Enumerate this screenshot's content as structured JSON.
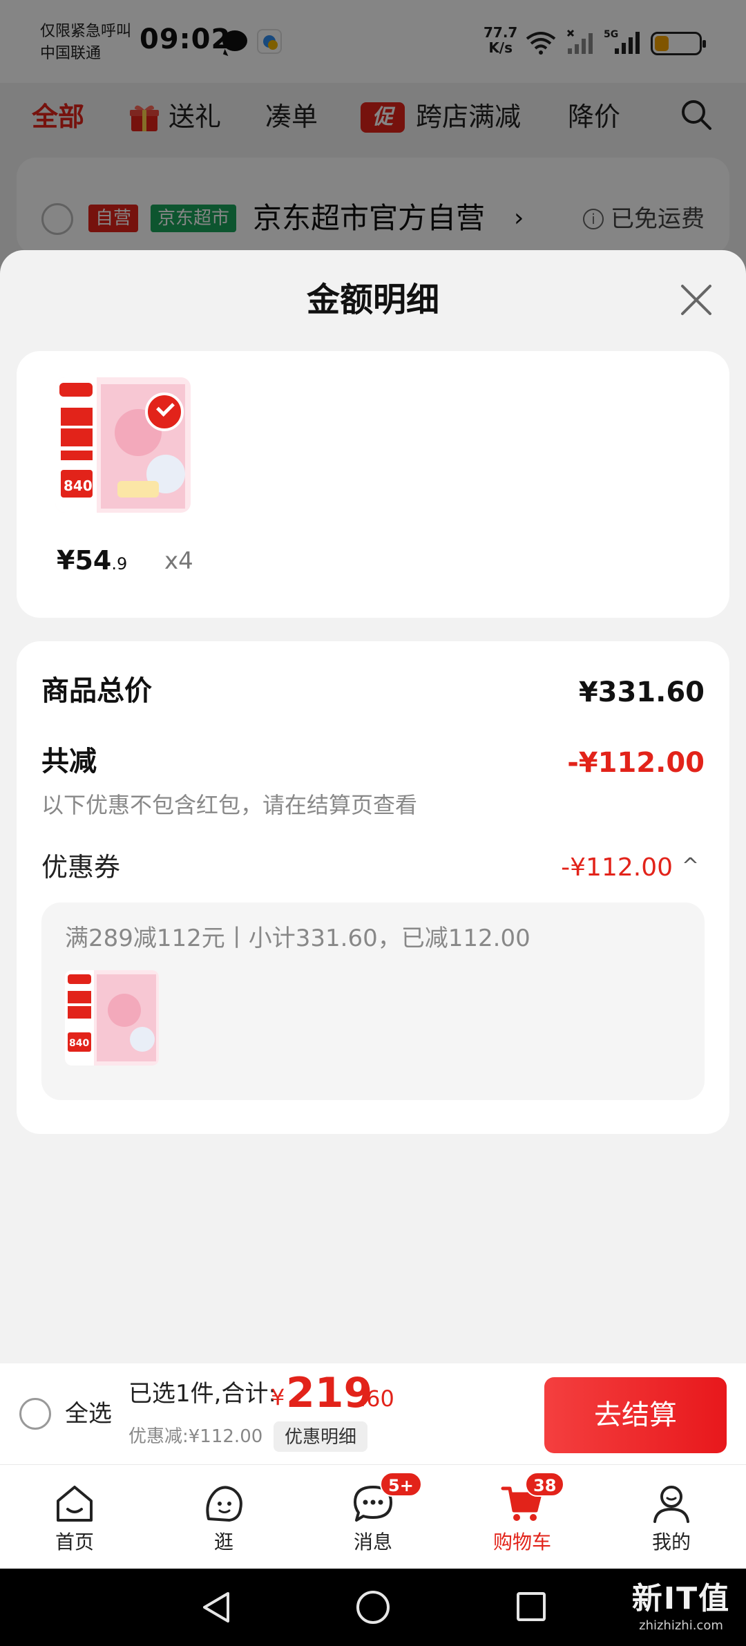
{
  "status_bar": {
    "carrier_line1": "仅限紧急呼叫",
    "carrier_line2": "中国联通",
    "time": "09:02",
    "speed_value": "77.7",
    "speed_unit": "K/s",
    "network": "5G"
  },
  "filter_tabs": {
    "all": "全部",
    "gift": "送礼",
    "bundle": "凑单",
    "promo_badge": "促",
    "cross_store": "跨店满减",
    "price_drop": "降价"
  },
  "shop": {
    "tag_self": "自营",
    "tag_market": "京东超市",
    "name": "京东超市官方自营",
    "chevron": "›",
    "shipping": "已免运费"
  },
  "sheet": {
    "title": "金额明细",
    "item": {
      "price_int": "¥54",
      "price_dec": ".9",
      "qty": "x4"
    },
    "summary": {
      "total_label": "商品总价",
      "total_value": "¥331.60",
      "reduce_label": "共减",
      "reduce_value": "-¥112.00",
      "hint": "以下优惠不包含红包，请在结算页查看",
      "coupon_label": "优惠券",
      "coupon_value": "-¥112.00",
      "coupon_chevron": "^",
      "coupon_desc": "满289减112元丨小计331.60，已减112.00"
    }
  },
  "checkout": {
    "select_all": "全选",
    "selected_text": "已选1件,合计:",
    "total_currency": "¥",
    "total_int": "219",
    "total_dec": ".60",
    "discount_text": "优惠减:¥112.00",
    "detail_button": "优惠明细",
    "checkout_button": "去结算"
  },
  "tab_bar": {
    "tabs": [
      {
        "label": "首页",
        "icon": "home-icon"
      },
      {
        "label": "逛",
        "icon": "browse-icon"
      },
      {
        "label": "消息",
        "icon": "message-icon",
        "badge": "5+"
      },
      {
        "label": "购物车",
        "icon": "cart-icon",
        "badge": "38",
        "active": true
      },
      {
        "label": "我的",
        "icon": "profile-icon"
      }
    ]
  },
  "watermark": {
    "brand": "新IT值",
    "domain": "zhizhizhi.com"
  },
  "colors": {
    "accent": "#e2231a",
    "green_tag": "#1aa35a",
    "overlay": "rgba(0,0,0,0.48)"
  }
}
